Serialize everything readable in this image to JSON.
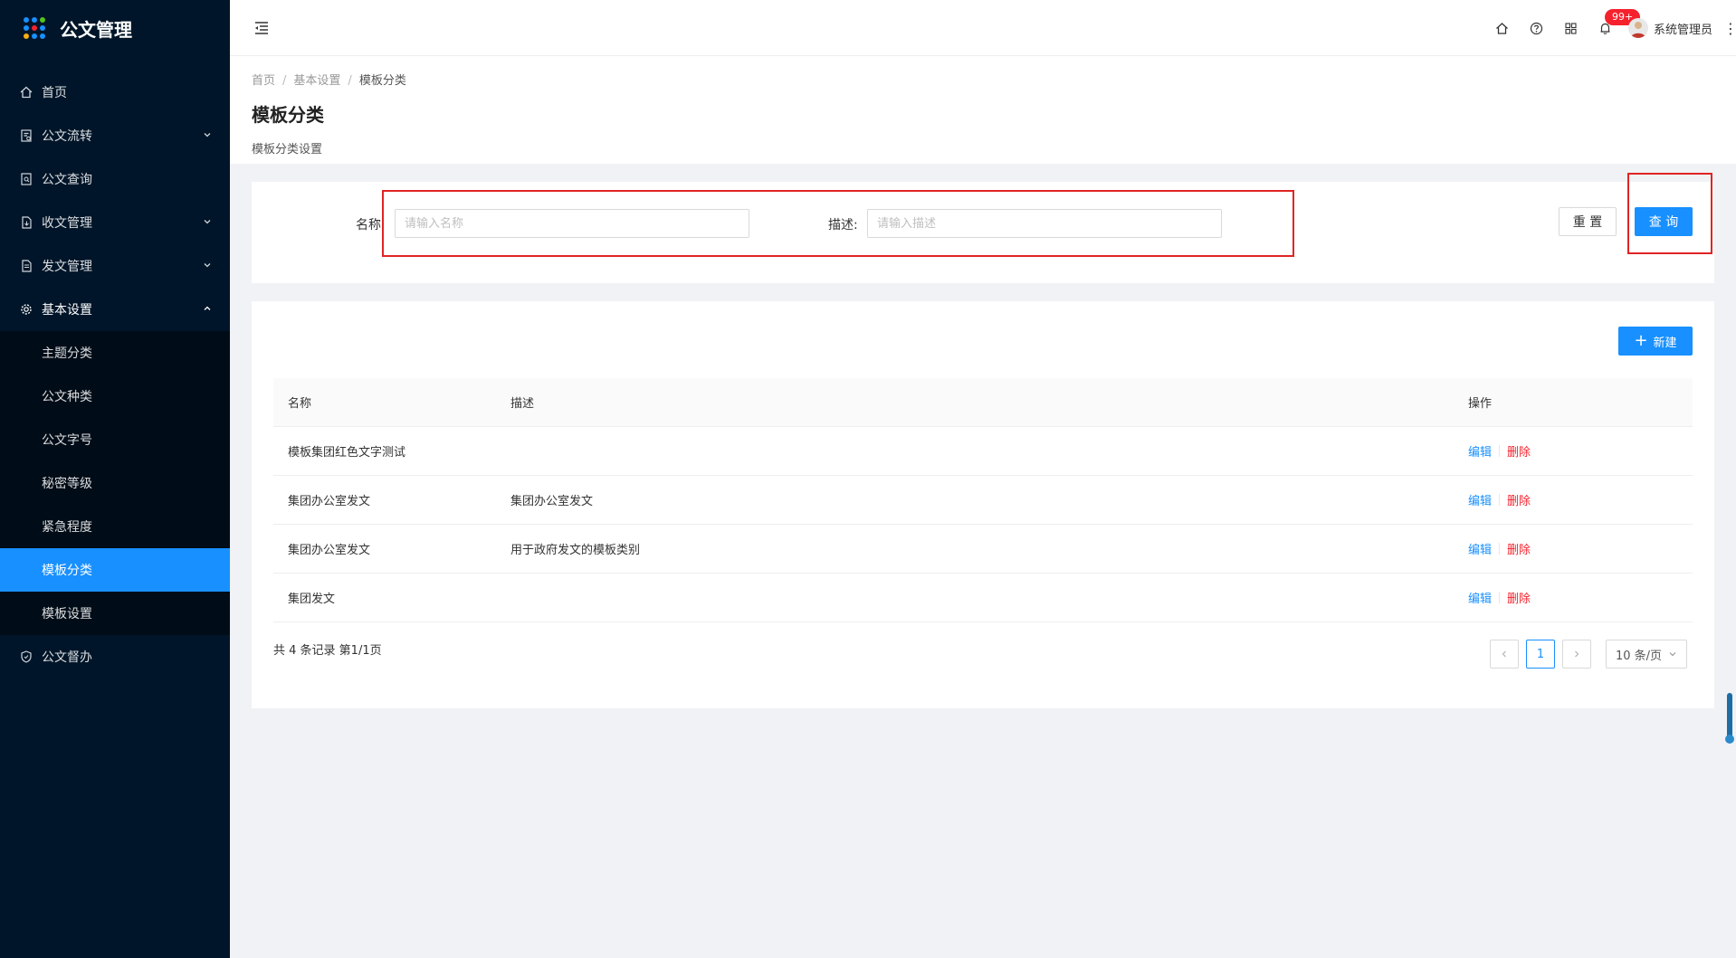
{
  "app": {
    "title": "公文管理"
  },
  "sidebar": {
    "items": [
      {
        "label": "首页",
        "icon": "home-icon",
        "hasArrow": false
      },
      {
        "label": "公文流转",
        "icon": "document-flow-icon",
        "hasArrow": true
      },
      {
        "label": "公文查询",
        "icon": "document-search-icon",
        "hasArrow": false
      },
      {
        "label": "收文管理",
        "icon": "inbox-document-icon",
        "hasArrow": true
      },
      {
        "label": "发文管理",
        "icon": "send-document-icon",
        "hasArrow": true
      },
      {
        "label": "基本设置",
        "icon": "gear-icon",
        "hasArrow": true,
        "open": true
      },
      {
        "label": "公文督办",
        "icon": "shield-icon",
        "hasArrow": false
      }
    ],
    "submenu": [
      {
        "label": "主题分类"
      },
      {
        "label": "公文种类"
      },
      {
        "label": "公文字号"
      },
      {
        "label": "秘密等级"
      },
      {
        "label": "紧急程度"
      },
      {
        "label": "模板分类",
        "active": true
      },
      {
        "label": "模板设置"
      }
    ]
  },
  "header": {
    "notification_badge": "99+",
    "user_name": "系统管理员"
  },
  "breadcrumb": [
    "首页",
    "基本设置",
    "模板分类"
  ],
  "page": {
    "title": "模板分类",
    "subtitle": "模板分类设置"
  },
  "search": {
    "name_label": "名称",
    "name_placeholder": "请输入名称",
    "desc_label": "描述:",
    "desc_placeholder": "请输入描述",
    "reset_label": "重 置",
    "query_label": "查 询"
  },
  "table": {
    "new_label": "新建",
    "columns": {
      "name": "名称",
      "desc": "描述",
      "op": "操作"
    },
    "rows": [
      {
        "name": "模板集团红色文字测试",
        "desc": "",
        "edit": "编辑",
        "del": "删除"
      },
      {
        "name": "集团办公室发文",
        "desc": "集团办公室发文",
        "edit": "编辑",
        "del": "删除"
      },
      {
        "name": "集团办公室发文",
        "desc": "用于政府发文的模板类别",
        "edit": "编辑",
        "del": "删除"
      },
      {
        "name": "集团发文",
        "desc": "",
        "edit": "编辑",
        "del": "删除"
      }
    ],
    "total_text": "共 4 条记录 第1/1页",
    "current_page": "1",
    "page_size": "10 条/页"
  },
  "colors": {
    "sidebar_bg": "#001529",
    "submenu_bg": "#000c17",
    "primary": "#1890ff",
    "danger": "#f5222d",
    "highlight_box": "#e02424"
  }
}
